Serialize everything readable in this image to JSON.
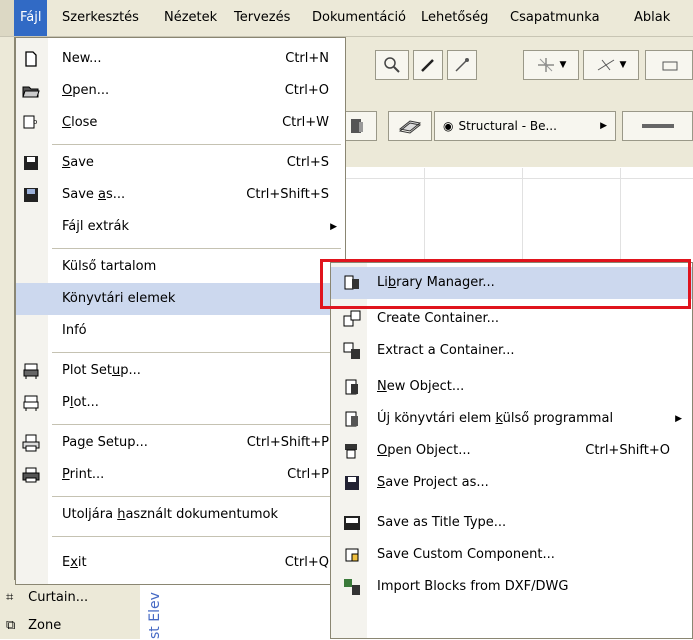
{
  "menubar": {
    "items": [
      "Fájl",
      "Szerkesztés",
      "Nézetek",
      "Tervezés",
      "Dokumentáció",
      "Lehetőség",
      "Csapatmunka",
      "Ablak"
    ]
  },
  "toolbar": {
    "view_button_label": "Structural - Be..."
  },
  "file_menu": {
    "items": [
      {
        "label": "New...",
        "shortcut": "Ctrl+N",
        "icon": "new-document-icon"
      },
      {
        "label": "Open...",
        "shortcut": "Ctrl+O",
        "icon": "open-folder-icon"
      },
      {
        "label": "Close",
        "shortcut": "Ctrl+W",
        "icon": "close-document-icon"
      },
      {
        "label": "Save",
        "shortcut": "Ctrl+S",
        "icon": "save-icon"
      },
      {
        "label": "Save as...",
        "shortcut": "Ctrl+Shift+S",
        "icon": "save-as-icon"
      },
      {
        "label": "Fájl extrák",
        "shortcut": ""
      },
      {
        "label": "Külső tartalom",
        "shortcut": ""
      },
      {
        "label": "Könyvtári elemek",
        "shortcut": ""
      },
      {
        "label": "Infó",
        "shortcut": ""
      },
      {
        "label": "Plot Setup...",
        "shortcut": "",
        "icon": "plot-setup-icon"
      },
      {
        "label": "Plot...",
        "shortcut": "",
        "icon": "plotter-icon"
      },
      {
        "label": "Page Setup...",
        "shortcut": "Ctrl+Shift+P",
        "icon": "page-setup-icon"
      },
      {
        "label": "Print...",
        "shortcut": "Ctrl+P",
        "icon": "printer-icon"
      },
      {
        "label": "Utoljára használt dokumentumok",
        "shortcut": ""
      },
      {
        "label": "Exit",
        "shortcut": "Ctrl+Q"
      }
    ]
  },
  "library_submenu": {
    "items": [
      {
        "label": "Library Manager...",
        "shortcut": ""
      },
      {
        "label": "Create Container...",
        "shortcut": ""
      },
      {
        "label": "Extract a Container...",
        "shortcut": ""
      },
      {
        "label": "New Object...",
        "shortcut": ""
      },
      {
        "label": "Új könyvtári elem külső programmal",
        "shortcut": ""
      },
      {
        "label": "Open Object...",
        "shortcut": "Ctrl+Shift+O"
      },
      {
        "label": "Save Project as...",
        "shortcut": ""
      },
      {
        "label": "Save as Title Type...",
        "shortcut": ""
      },
      {
        "label": "Save Custom Component...",
        "shortcut": ""
      },
      {
        "label": "Import Blocks from DXF/DWG",
        "shortcut": ""
      }
    ]
  },
  "toolbox": {
    "items": [
      "Curtain...",
      "Zone"
    ]
  },
  "canvas": {
    "vertical_label": "st Elev"
  },
  "colors": {
    "highlight": "#ccd8ee",
    "menubar_active": "#316ac5",
    "annotation_box": "#e0141d"
  }
}
